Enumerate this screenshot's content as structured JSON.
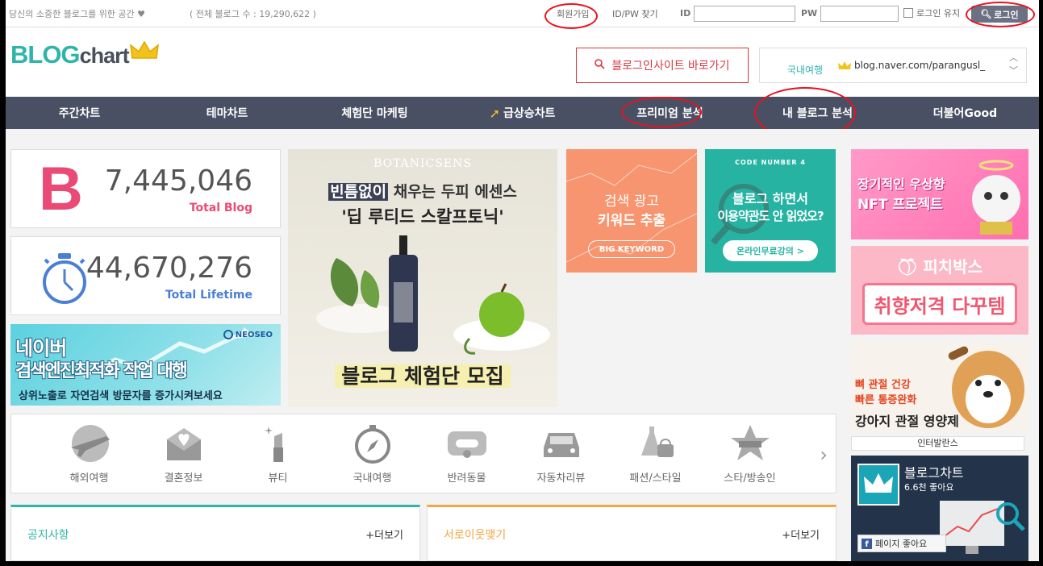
{
  "topbar": {
    "slogan": "당신의 소중한 블로그를 위한 공간 ♥",
    "total_blogs": "( 전체 블로그 수 : 19,290,622 )",
    "join": "회원가입",
    "find": "ID/PW 찾기",
    "id_label": "ID",
    "pw_label": "PW",
    "id_value": "",
    "pw_value": "",
    "keep_login": "로그인 유지",
    "login": "로그인"
  },
  "header": {
    "logo_blog": "BLOG",
    "logo_chart": "chart",
    "go_button": "블로그인사이트 바로가기",
    "ticker_category": "국내여행",
    "ticker_url": "blog.naver.com/parangusl_"
  },
  "nav": [
    {
      "label": "주간차트"
    },
    {
      "label": "테마차트"
    },
    {
      "label": "체험단 마케팅"
    },
    {
      "label": "급상승차트"
    },
    {
      "label": "프리미엄 분석"
    },
    {
      "label": "내 블로그 분석"
    },
    {
      "label": "더불어Good"
    }
  ],
  "stats": {
    "total_blog": "7,445,046",
    "total_blog_label": "Total Blog",
    "total_lifetime": "44,670,276",
    "total_lifetime_label": "Total Lifetime"
  },
  "banners": {
    "neoseo_brand": "NEOSEO",
    "neoseo_l1": "네이버",
    "neoseo_l2": "검색엔진최적화 작업 대행",
    "neoseo_l3": "상위노출로 자연검색 방문자를 증가시켜보세요",
    "botan_brand": "BOTANICSENS",
    "botan_h1_hl": "빈틈없이",
    "botan_h1_rest": " 채우는 두피 에센스",
    "botan_h2": "'딥 루티드 스칼프토닉'",
    "botan_cta": "블로그 체험단 모집",
    "kw_t1": "검색 광고",
    "kw_t2": "키워드 추출",
    "kw_pill": "BIG KEYWORD",
    "cn4_t0": "CODE NUMBER 4",
    "cn4_t1": "블로그 하면서",
    "cn4_t2": "이용약관도 안 읽었오?",
    "cn4_pill": "온라인무료강의 >",
    "nft_t1": "장기적인 우상향",
    "nft_t2": "NFT 프로젝트",
    "peach_t1": "피치박스",
    "peach_t2": "취향저격 다꾸템",
    "dog_t1": "뼈 관절 건강",
    "dog_t2": "빠른 통증완화",
    "dog_t3": "강아지 관절 영양제",
    "inter": "인터발란스",
    "fb_name": "블로그차트",
    "fb_likes": "6.6천 좋아요",
    "fb_like_btn": "페이지 좋아요"
  },
  "categories": [
    {
      "label": "해외여행",
      "icon": "airplane-icon"
    },
    {
      "label": "결혼정보",
      "icon": "envelope-heart-icon"
    },
    {
      "label": "뷰티",
      "icon": "lipstick-icon"
    },
    {
      "label": "국내여행",
      "icon": "compass-icon"
    },
    {
      "label": "반려동물",
      "icon": "pet-bone-icon"
    },
    {
      "label": "자동차리뷰",
      "icon": "car-icon"
    },
    {
      "label": "패션/스타일",
      "icon": "dress-bag-icon"
    },
    {
      "label": "스타/방송인",
      "icon": "star-badge-icon"
    }
  ],
  "boards": {
    "notice": "공지사항",
    "notice_more": "+더보기",
    "neighbor": "서로이웃맺기",
    "neighbor_more": "+더보기"
  },
  "colors": {
    "nav_bg": "#4a5064",
    "brand_teal": "#2eb5a9",
    "brand_pink": "#e94b76",
    "accent_red": "#d9363e",
    "annotation_red": "#e8121f"
  }
}
